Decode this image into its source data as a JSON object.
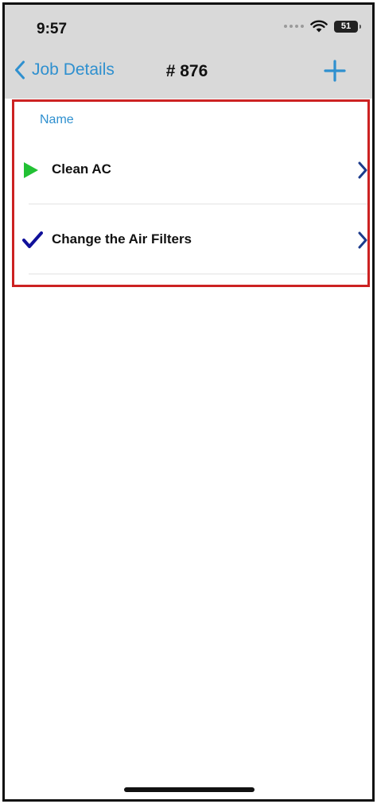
{
  "status_bar": {
    "time": "9:57",
    "battery": "51"
  },
  "nav_bar": {
    "back_label": "Job Details",
    "title": "# 876",
    "add_icon": "plus-icon"
  },
  "list": {
    "header": "Name",
    "items": [
      {
        "label": "Clean AC",
        "status_icon": "play-icon",
        "status_color": "#22c134"
      },
      {
        "label": "Change the Air Filters",
        "status_icon": "checkmark-icon",
        "status_color": "#10109a"
      }
    ]
  },
  "colors": {
    "accent": "#2f90cf",
    "highlight": "#cc2222",
    "chevron": "#1c3b8c"
  }
}
